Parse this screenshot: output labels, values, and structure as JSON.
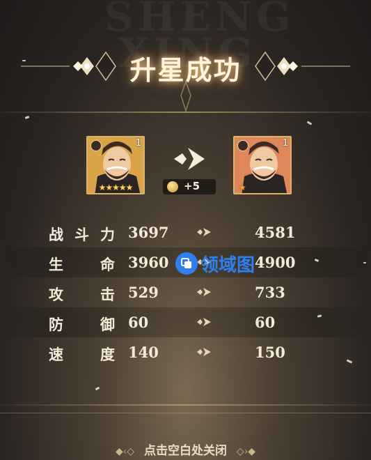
{
  "background_text": [
    "SHENG",
    "XING"
  ],
  "title": "升星成功",
  "before_card": {
    "level": "1",
    "stars": "★★★★★"
  },
  "after_card": {
    "level": "1",
    "stars": "★"
  },
  "cost": {
    "icon": "coin-icon",
    "amount": "+5"
  },
  "stats": [
    {
      "label": [
        "战",
        "斗",
        "力"
      ],
      "from": "3697",
      "to": "4581"
    },
    {
      "label": [
        "生",
        "命"
      ],
      "from": "3960",
      "to": "4900"
    },
    {
      "label": [
        "攻",
        "击"
      ],
      "from": "529",
      "to": "733"
    },
    {
      "label": [
        "防",
        "御"
      ],
      "from": "60",
      "to": "60"
    },
    {
      "label": [
        "速",
        "度"
      ],
      "from": "140",
      "to": "150"
    }
  ],
  "watermark": "领域图",
  "close_hint": "点击空白处关闭",
  "colors": {
    "gold": "#d8b36a",
    "title_glow": "#ffd28c",
    "watermark": "#2f7ff0"
  }
}
